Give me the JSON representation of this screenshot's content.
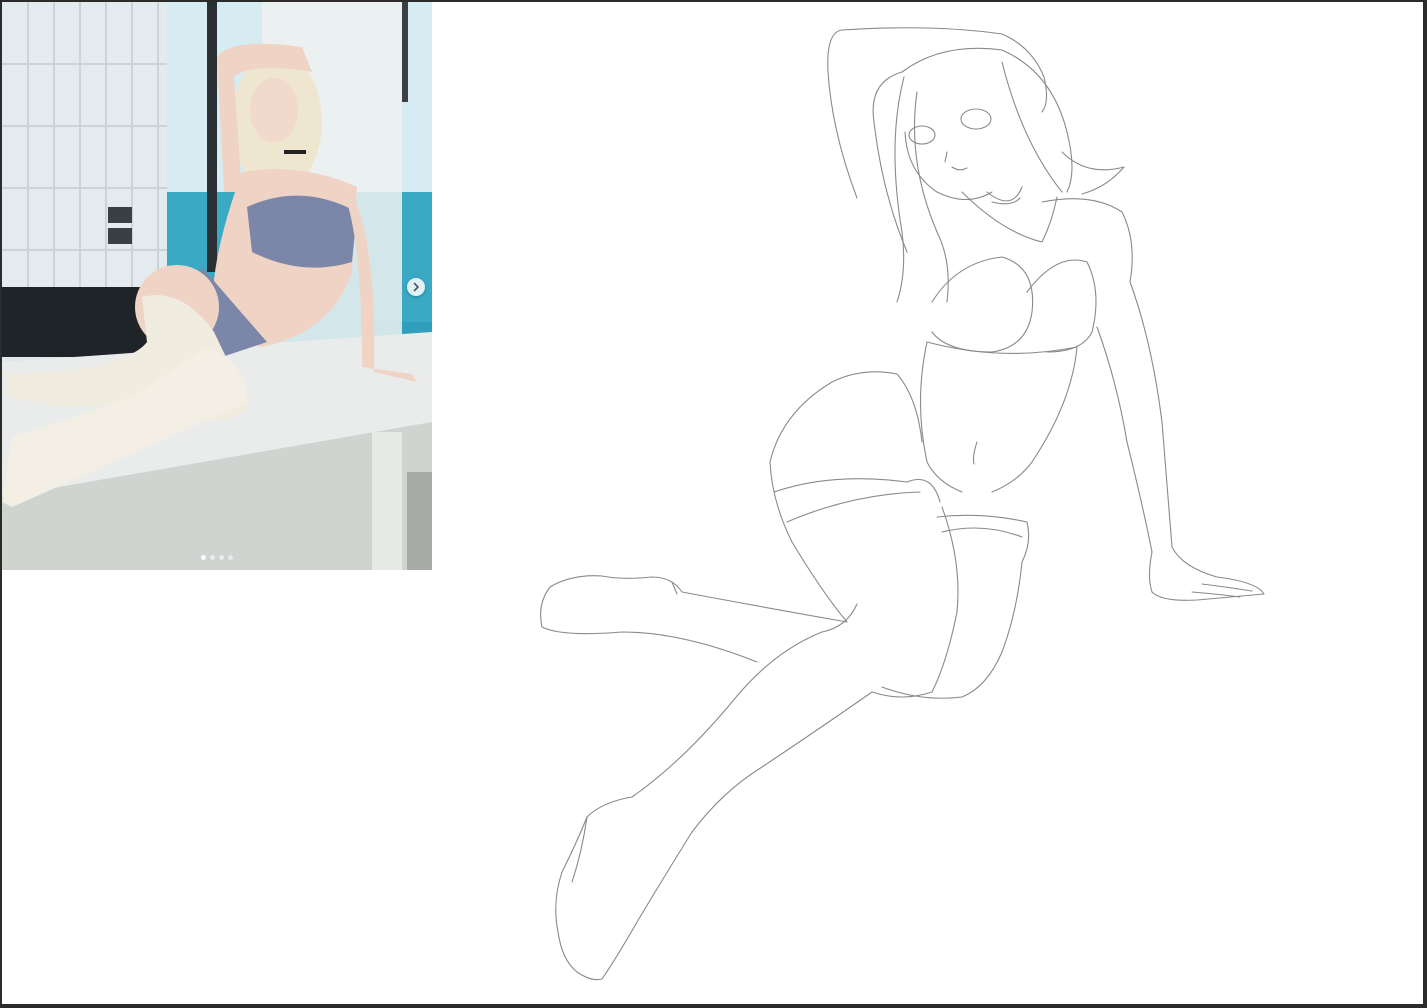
{
  "canvas": {
    "background": "#ffffff",
    "frame_color": "#2b2b2b"
  },
  "reference_photo": {
    "carousel": {
      "slide_count": 4,
      "active_slide": 1,
      "next_icon": "chevron-right-icon"
    },
    "colors": {
      "sea": "#3aa9c4",
      "sky": "#cfe7ef",
      "wall_tiles": "#e4ebee",
      "counter": "#e9ecea",
      "lingerie": "#7b86a8",
      "stockings": "#f1ece0",
      "skin": "#efd4c6",
      "hair": "#efe6cf"
    }
  },
  "sketch": {
    "stroke_color": "#8a8a8a"
  }
}
